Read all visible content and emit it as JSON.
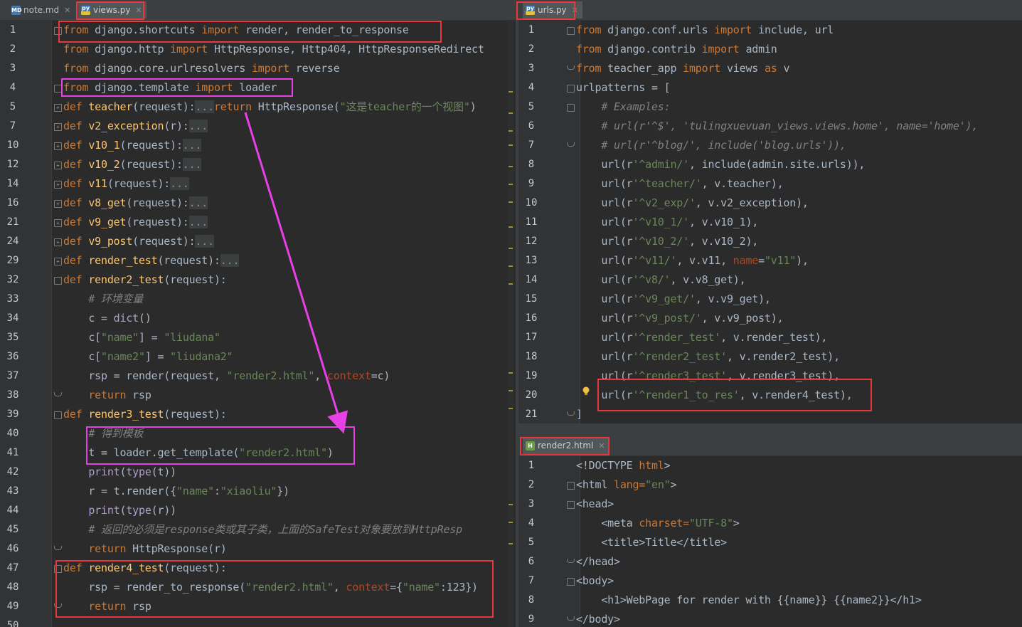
{
  "left": {
    "tabs": [
      {
        "label": "note.md",
        "icon": "markdown-file-icon"
      },
      {
        "label": "views.py",
        "icon": "python-file-icon"
      }
    ],
    "lines": [
      {
        "no": "1",
        "segs": [
          [
            "k",
            "from "
          ],
          [
            "",
            "django.shortcuts "
          ],
          [
            "k",
            "import "
          ],
          [
            "",
            "render, render_to_response"
          ]
        ]
      },
      {
        "no": "2",
        "segs": [
          [
            "k",
            "from "
          ],
          [
            "",
            "django.http "
          ],
          [
            "k",
            "import "
          ],
          [
            "",
            "HttpResponse, Http404, HttpResponseRedirect"
          ]
        ]
      },
      {
        "no": "3",
        "segs": [
          [
            "k",
            "from "
          ],
          [
            "",
            "django.core.urlresolvers "
          ],
          [
            "k",
            "import "
          ],
          [
            "",
            "reverse"
          ]
        ]
      },
      {
        "no": "4",
        "segs": [
          [
            "k",
            "from "
          ],
          [
            "",
            "django.template "
          ],
          [
            "k",
            "import "
          ],
          [
            "",
            "loader"
          ]
        ]
      },
      {
        "no": "5",
        "segs": [
          [
            "k",
            "def "
          ],
          [
            "f",
            "teacher"
          ],
          [
            "",
            "(request):"
          ],
          [
            "collapsed",
            "..."
          ],
          [
            "k",
            "return "
          ],
          [
            "",
            "HttpResponse("
          ],
          [
            "s",
            "\"这是teacher的一个视图\""
          ],
          [
            "",
            ")"
          ]
        ]
      },
      {
        "no": "7",
        "segs": [
          [
            "k",
            "def "
          ],
          [
            "f",
            "v2_exception"
          ],
          [
            "",
            "(r):"
          ],
          [
            "collapsed",
            "..."
          ]
        ]
      },
      {
        "no": "10",
        "segs": [
          [
            "k",
            "def "
          ],
          [
            "f",
            "v10_1"
          ],
          [
            "",
            "(request):"
          ],
          [
            "collapsed",
            "..."
          ]
        ]
      },
      {
        "no": "12",
        "segs": [
          [
            "k",
            "def "
          ],
          [
            "f",
            "v10_2"
          ],
          [
            "",
            "(request):"
          ],
          [
            "collapsed",
            "..."
          ]
        ]
      },
      {
        "no": "14",
        "segs": [
          [
            "k",
            "def "
          ],
          [
            "f",
            "v11"
          ],
          [
            "",
            "(request):"
          ],
          [
            "collapsed",
            "..."
          ]
        ]
      },
      {
        "no": "16",
        "segs": [
          [
            "k",
            "def "
          ],
          [
            "f",
            "v8_get"
          ],
          [
            "",
            "(request):"
          ],
          [
            "collapsed",
            "..."
          ]
        ]
      },
      {
        "no": "21",
        "segs": [
          [
            "k",
            "def "
          ],
          [
            "f",
            "v9_get"
          ],
          [
            "",
            "(request):"
          ],
          [
            "collapsed",
            "..."
          ]
        ]
      },
      {
        "no": "24",
        "segs": [
          [
            "k",
            "def "
          ],
          [
            "f",
            "v9_post"
          ],
          [
            "",
            "(request):"
          ],
          [
            "collapsed",
            "..."
          ]
        ]
      },
      {
        "no": "29",
        "segs": [
          [
            "k",
            "def "
          ],
          [
            "f",
            "render_test"
          ],
          [
            "",
            "(request):"
          ],
          [
            "collapsed",
            "..."
          ]
        ]
      },
      {
        "no": "32",
        "segs": [
          [
            "k",
            "def "
          ],
          [
            "f",
            "render2_test"
          ],
          [
            "",
            "(request):"
          ]
        ]
      },
      {
        "no": "33",
        "segs": [
          [
            "",
            "    "
          ],
          [
            "c",
            "# 环境变量"
          ]
        ]
      },
      {
        "no": "34",
        "segs": [
          [
            "",
            "    c = "
          ],
          [
            "fn",
            "dict"
          ],
          [
            "",
            "()"
          ]
        ]
      },
      {
        "no": "35",
        "segs": [
          [
            "",
            "    c["
          ],
          [
            "s",
            "\"name\""
          ],
          [
            "",
            "] = "
          ],
          [
            "s",
            "\"liudana\""
          ]
        ]
      },
      {
        "no": "36",
        "segs": [
          [
            "",
            "    c["
          ],
          [
            "s",
            "\"name2\""
          ],
          [
            "",
            "] = "
          ],
          [
            "s",
            "\"liudana2\""
          ]
        ]
      },
      {
        "no": "37",
        "segs": [
          [
            "",
            "    rsp = render(request, "
          ],
          [
            "s",
            "\"render2.html\""
          ],
          [
            "",
            ", "
          ],
          [
            "p",
            "context"
          ],
          [
            "",
            "=c)"
          ]
        ]
      },
      {
        "no": "38",
        "segs": [
          [
            "",
            "    "
          ],
          [
            "k",
            "return "
          ],
          [
            "",
            "rsp"
          ]
        ]
      },
      {
        "no": "39",
        "segs": [
          [
            "k",
            "def "
          ],
          [
            "f",
            "render3_test"
          ],
          [
            "",
            "(request):"
          ]
        ]
      },
      {
        "no": "40",
        "segs": [
          [
            "",
            "    "
          ],
          [
            "c",
            "# 得到模板"
          ]
        ]
      },
      {
        "no": "41",
        "segs": [
          [
            "",
            "    t = loader.get_template("
          ],
          [
            "s",
            "\"render2.html\""
          ],
          [
            "",
            ")"
          ]
        ]
      },
      {
        "no": "42",
        "segs": [
          [
            "",
            "    "
          ],
          [
            "fn",
            "print"
          ],
          [
            "",
            "("
          ],
          [
            "fn",
            "type"
          ],
          [
            "",
            "(t))"
          ]
        ]
      },
      {
        "no": "43",
        "segs": [
          [
            "",
            "    r = t.render({"
          ],
          [
            "s",
            "\"name\""
          ],
          [
            "",
            ":"
          ],
          [
            "s",
            "\"xiaoliu\""
          ],
          [
            "",
            "})"
          ]
        ]
      },
      {
        "no": "44",
        "segs": [
          [
            "",
            "    "
          ],
          [
            "fn",
            "print"
          ],
          [
            "",
            "("
          ],
          [
            "fn",
            "type"
          ],
          [
            "",
            "(r))"
          ]
        ]
      },
      {
        "no": "45",
        "segs": [
          [
            "",
            "    "
          ],
          [
            "c",
            "# 返回的必须是response类或其子类，上面的SafeTest对象要放到HttpResp"
          ]
        ]
      },
      {
        "no": "46",
        "segs": [
          [
            "",
            "    "
          ],
          [
            "k",
            "return "
          ],
          [
            "",
            "HttpResponse(r)"
          ]
        ]
      },
      {
        "no": "47",
        "segs": [
          [
            "k",
            "def "
          ],
          [
            "f",
            "render4_test"
          ],
          [
            "",
            "(request):"
          ]
        ]
      },
      {
        "no": "48",
        "segs": [
          [
            "",
            "    rsp = render_to_response("
          ],
          [
            "s",
            "\"render2.html\""
          ],
          [
            "",
            ", "
          ],
          [
            "p",
            "context"
          ],
          [
            "",
            "={"
          ],
          [
            "s",
            "\"name\""
          ],
          [
            "",
            ":123})"
          ]
        ]
      },
      {
        "no": "49",
        "segs": [
          [
            "",
            "    "
          ],
          [
            "k",
            "return "
          ],
          [
            "",
            "rsp"
          ]
        ]
      },
      {
        "no": "50",
        "segs": []
      }
    ]
  },
  "urls": {
    "tab": {
      "label": "urls.py",
      "icon": "python-file-icon"
    },
    "lines": [
      {
        "no": "1",
        "segs": [
          [
            "k",
            "from "
          ],
          [
            "",
            "django.conf.urls "
          ],
          [
            "k",
            "import "
          ],
          [
            "",
            "include, url"
          ]
        ]
      },
      {
        "no": "2",
        "segs": [
          [
            "k",
            "from "
          ],
          [
            "",
            "django.contrib "
          ],
          [
            "k",
            "import "
          ],
          [
            "",
            "admin"
          ]
        ]
      },
      {
        "no": "3",
        "segs": [
          [
            "k",
            "from "
          ],
          [
            "",
            "teacher_app "
          ],
          [
            "k",
            "import "
          ],
          [
            "",
            "views "
          ],
          [
            "k",
            "as "
          ],
          [
            "",
            "v"
          ]
        ]
      },
      {
        "no": "4",
        "segs": [
          [
            "",
            "urlpatterns = ["
          ]
        ]
      },
      {
        "no": "5",
        "segs": [
          [
            "",
            "    "
          ],
          [
            "c",
            "# Examples:"
          ]
        ]
      },
      {
        "no": "6",
        "segs": [
          [
            "",
            "    "
          ],
          [
            "c",
            "# url(r'^$', 'tulingxuevuan_views.views.home', name='home'),"
          ]
        ]
      },
      {
        "no": "7",
        "segs": [
          [
            "",
            "    "
          ],
          [
            "c",
            "# url(r'^blog/', include('blog.urls')),"
          ]
        ]
      },
      {
        "no": "8",
        "segs": [
          [
            "",
            "    url(r"
          ],
          [
            "s",
            "'^admin/'"
          ],
          [
            "",
            ", include(admin.site.urls)),"
          ]
        ]
      },
      {
        "no": "9",
        "segs": [
          [
            "",
            "    url(r"
          ],
          [
            "s",
            "'^teacher/'"
          ],
          [
            "",
            ", v.teacher),"
          ]
        ]
      },
      {
        "no": "10",
        "segs": [
          [
            "",
            "    url(r"
          ],
          [
            "s",
            "'^v2_exp/'"
          ],
          [
            "",
            ", v.v2_exception),"
          ]
        ]
      },
      {
        "no": "11",
        "segs": [
          [
            "",
            "    url(r"
          ],
          [
            "s",
            "'^v10_1/'"
          ],
          [
            "",
            ", v.v10_1),"
          ]
        ]
      },
      {
        "no": "12",
        "segs": [
          [
            "",
            "    url(r"
          ],
          [
            "s",
            "'^v10_2/'"
          ],
          [
            "",
            ", v.v10_2),"
          ]
        ]
      },
      {
        "no": "13",
        "segs": [
          [
            "",
            "    url(r"
          ],
          [
            "s",
            "'^v11/'"
          ],
          [
            "",
            ", v.v11, "
          ],
          [
            "p",
            "name"
          ],
          [
            "",
            "="
          ],
          [
            "s",
            "\"v11\""
          ],
          [
            "",
            "),"
          ]
        ]
      },
      {
        "no": "14",
        "segs": [
          [
            "",
            "    url(r"
          ],
          [
            "s",
            "'^v8/'"
          ],
          [
            "",
            ", v.v8_get),"
          ]
        ]
      },
      {
        "no": "15",
        "segs": [
          [
            "",
            "    url(r"
          ],
          [
            "s",
            "'^v9_get/'"
          ],
          [
            "",
            ", v.v9_get),"
          ]
        ]
      },
      {
        "no": "16",
        "segs": [
          [
            "",
            "    url(r"
          ],
          [
            "s",
            "'^v9_post/'"
          ],
          [
            "",
            ", v.v9_post),"
          ]
        ]
      },
      {
        "no": "17",
        "segs": [
          [
            "",
            "    url(r"
          ],
          [
            "s",
            "'^render_test'"
          ],
          [
            "",
            ", v.render_test),"
          ]
        ]
      },
      {
        "no": "18",
        "segs": [
          [
            "",
            "    url(r"
          ],
          [
            "s",
            "'^render2_test'"
          ],
          [
            "",
            ", v.render2_test),"
          ]
        ]
      },
      {
        "no": "19",
        "segs": [
          [
            "",
            "    url(r"
          ],
          [
            "s",
            "'^render3_test'"
          ],
          [
            "",
            ", v.render3_test),"
          ]
        ]
      },
      {
        "no": "20",
        "segs": [
          [
            "",
            "    url(r"
          ],
          [
            "s",
            "'^render1_to_res'"
          ],
          [
            "",
            ", v.render4_test),"
          ]
        ]
      },
      {
        "no": "21",
        "segs": [
          [
            "",
            "]"
          ]
        ]
      }
    ]
  },
  "html": {
    "tab": {
      "label": "render2.html",
      "icon": "html-file-icon"
    },
    "lines": [
      {
        "no": "1",
        "segs": [
          [
            "",
            "<!DOCTYPE "
          ],
          [
            "k",
            "html"
          ],
          [
            "",
            ">"
          ]
        ]
      },
      {
        "no": "2",
        "segs": [
          [
            "",
            "<html "
          ],
          [
            "k",
            "lang="
          ],
          [
            "s",
            "\"en\""
          ],
          [
            "",
            ">"
          ]
        ]
      },
      {
        "no": "3",
        "segs": [
          [
            "",
            "<head>"
          ]
        ]
      },
      {
        "no": "4",
        "segs": [
          [
            "",
            "    <meta "
          ],
          [
            "k",
            "charset="
          ],
          [
            "s",
            "\"UTF-8\""
          ],
          [
            "",
            ">"
          ]
        ]
      },
      {
        "no": "5",
        "segs": [
          [
            "",
            "    <title>Title</title>"
          ]
        ]
      },
      {
        "no": "6",
        "segs": [
          [
            "",
            "</head>"
          ]
        ]
      },
      {
        "no": "7",
        "segs": [
          [
            "",
            "<body>"
          ]
        ]
      },
      {
        "no": "8",
        "segs": [
          [
            "",
            "    <h1>WebPage for render with {{name}} {{name2}}</h1>"
          ]
        ]
      },
      {
        "no": "9",
        "segs": [
          [
            "",
            "</body>"
          ]
        ]
      }
    ]
  },
  "colors": {
    "annotation_red": "#e8383c",
    "annotation_magenta": "#e640e6",
    "editor_bg": "#2b2b2b"
  }
}
